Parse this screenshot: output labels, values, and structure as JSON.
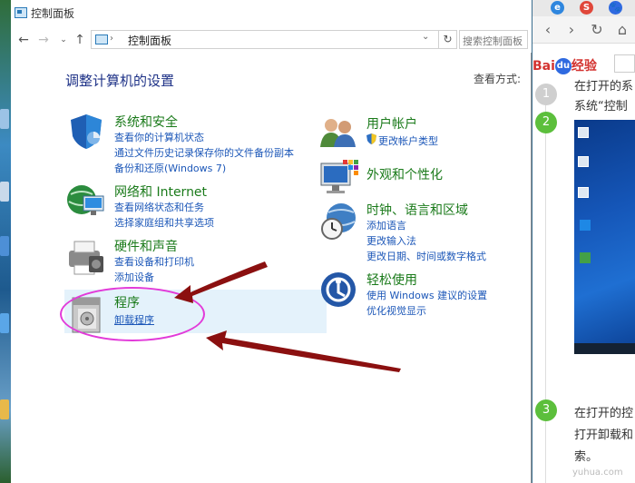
{
  "window": {
    "title": "控制面板",
    "address": "控制面板",
    "search_placeholder": "搜索控制面板",
    "heading": "调整计算机的设置",
    "view_by": "查看方式:"
  },
  "categories_left": [
    {
      "title": "系统和安全",
      "icon": "shield-icon",
      "links": [
        "查看你的计算机状态",
        "通过文件历史记录保存你的文件备份副本",
        "备份和还原(Windows 7)"
      ]
    },
    {
      "title": "网络和 Internet",
      "icon": "network-globe-icon",
      "links": [
        "查看网络状态和任务",
        "选择家庭组和共享选项"
      ]
    },
    {
      "title": "硬件和声音",
      "icon": "printer-icon",
      "links": [
        "查看设备和打印机",
        "添加设备"
      ]
    },
    {
      "title": "程序",
      "icon": "programs-box-icon",
      "links": [
        "卸载程序"
      ]
    }
  ],
  "categories_right": [
    {
      "title": "用户帐户",
      "icon": "users-icon",
      "links": [
        "更改帐户类型"
      ]
    },
    {
      "title": "外观和个性化",
      "icon": "monitor-palette-icon",
      "links": []
    },
    {
      "title": "时钟、语言和区域",
      "icon": "clock-globe-icon",
      "links": [
        "添加语言",
        "更改输入法",
        "更改日期、时间或数字格式"
      ]
    },
    {
      "title": "轻松使用",
      "icon": "ease-of-access-icon",
      "links": [
        "使用 Windows 建议的设置",
        "优化视觉显示"
      ]
    }
  ],
  "browser": {
    "logo_text": "Bai",
    "logo_du": "du",
    "logo_suffix": "经验",
    "steps": [
      "1",
      "2",
      "3"
    ],
    "text_line1": "在打开的系",
    "text_line2": "系统“控制",
    "text_line3": "在打开的控",
    "text_line4": "打开卸载和",
    "text_line5": "索。",
    "watermark": "yuhua.com"
  },
  "colors": {
    "heading": "#1e3287",
    "category_title": "#1a7a1a",
    "link": "#1c57b8",
    "highlight": "#e4f2fb",
    "annotation_ellipse": "#e23ad9",
    "annotation_arrow": "#8b1010",
    "baidu_red": "#d3322f",
    "step_green": "#5cbf3c"
  }
}
